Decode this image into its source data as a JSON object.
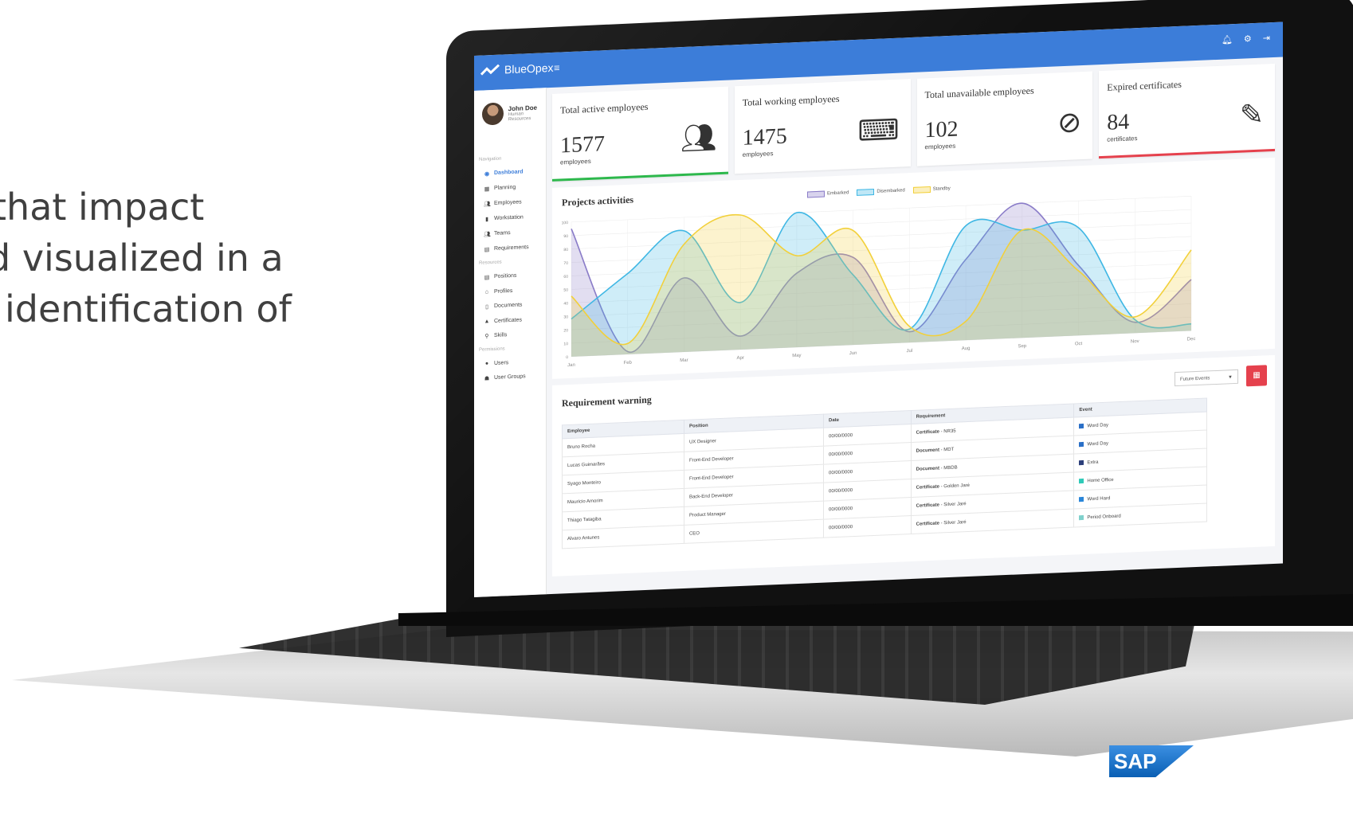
{
  "slide": {
    "lines": [
      "that impact",
      "d visualized in a",
      "identification of"
    ]
  },
  "app": {
    "brand": "BlueOpex",
    "menu_icon": "hamburger-icon",
    "top_icons": [
      "bell-icon",
      "gear-icon",
      "logout-icon"
    ]
  },
  "user": {
    "name": "John Doe",
    "role": "Human Resources"
  },
  "sidebar": {
    "sections": [
      {
        "label": "Navigation",
        "items": [
          {
            "label": "Dashboard",
            "icon": "dashboard-icon",
            "active": true
          },
          {
            "label": "Planning",
            "icon": "calendar-icon"
          },
          {
            "label": "Employees",
            "icon": "users-icon"
          },
          {
            "label": "Workstation",
            "icon": "building-icon"
          },
          {
            "label": "Teams",
            "icon": "team-icon"
          },
          {
            "label": "Requirements",
            "icon": "list-icon"
          }
        ]
      },
      {
        "label": "Resources",
        "items": [
          {
            "label": "Positions",
            "icon": "table-icon"
          },
          {
            "label": "Profiles",
            "icon": "bank-icon"
          },
          {
            "label": "Documents",
            "icon": "file-icon"
          },
          {
            "label": "Certificates",
            "icon": "graduation-cap-icon"
          },
          {
            "label": "Skills",
            "icon": "pin-icon"
          }
        ]
      },
      {
        "label": "Permissions",
        "items": [
          {
            "label": "Users",
            "icon": "user-icon"
          },
          {
            "label": "User Groups",
            "icon": "user-group-icon"
          }
        ]
      }
    ]
  },
  "cards": [
    {
      "title": "Total active employees",
      "value": "1577",
      "unit": "employees",
      "icon": "people-icon",
      "bar_color": "#2db84c"
    },
    {
      "title": "Total working employees",
      "value": "1475",
      "unit": "employees",
      "icon": "desk-worker-icon",
      "bar_color": ""
    },
    {
      "title": "Total unavailable employees",
      "value": "102",
      "unit": "employees",
      "icon": "ban-icon",
      "bar_color": ""
    },
    {
      "title": "Expired certificates",
      "value": "84",
      "unit": "certificates",
      "icon": "certificate-icon",
      "bar_color": "#e5414d"
    }
  ],
  "chart_panel": {
    "title": "Projects activities"
  },
  "chart_data": {
    "type": "area",
    "categories": [
      "Jan",
      "Feb",
      "Mar",
      "Apr",
      "May",
      "Jun",
      "Jul",
      "Aug",
      "Sep",
      "Oct",
      "Nov",
      "Dec"
    ],
    "ylim": [
      0,
      100
    ],
    "yticks": [
      0,
      10,
      20,
      30,
      40,
      50,
      60,
      70,
      80,
      90,
      100
    ],
    "grid": true,
    "legend_position": "top",
    "series": [
      {
        "name": "Embarked",
        "color": "#8a7cc8",
        "values": [
          95,
          2,
          55,
          10,
          55,
          65,
          8,
          60,
          100,
          52,
          8,
          38
        ]
      },
      {
        "name": "Disembarked",
        "color": "#3fb7e4",
        "values": [
          28,
          60,
          90,
          35,
          100,
          52,
          10,
          85,
          80,
          80,
          10,
          5
        ]
      },
      {
        "name": "Standby",
        "color": "#f2d03a",
        "values": [
          45,
          8,
          80,
          100,
          68,
          85,
          12,
          14,
          80,
          48,
          12,
          60
        ]
      }
    ]
  },
  "requirements": {
    "title": "Requirement warning",
    "filter": "Future Events",
    "columns": [
      "Employee",
      "Position",
      "Date",
      "Requirement",
      "Event"
    ],
    "rows": [
      {
        "employee": "Bruno Rocha",
        "position": "UX Designer",
        "date": "00/00/0000",
        "req_type": "Certificate",
        "req_name": "NR35",
        "event": "Word Day",
        "event_color": "#2a6fc7"
      },
      {
        "employee": "Lucas Guimarães",
        "position": "Front-End Developer",
        "date": "00/00/0000",
        "req_type": "Document",
        "req_name": "MDT",
        "event": "Word Day",
        "event_color": "#2a6fc7"
      },
      {
        "employee": "Syago Monteiro",
        "position": "Front-End Developer",
        "date": "00/00/0000",
        "req_type": "Document",
        "req_name": "MBDB",
        "event": "Extra",
        "event_color": "#2c3f7a"
      },
      {
        "employee": "Mauricio Amorim",
        "position": "Back-End Developer",
        "date": "00/00/0000",
        "req_type": "Certificate",
        "req_name": "Golden Jaré",
        "event": "Home Office",
        "event_color": "#2fcab8"
      },
      {
        "employee": "Thiago Tatagiba",
        "position": "Product Manager",
        "date": "00/00/0000",
        "req_type": "Certificate",
        "req_name": "Silver Jaré",
        "event": "Word Hard",
        "event_color": "#2a86d9"
      },
      {
        "employee": "Alvaro Antunes",
        "position": "CEO",
        "date": "00/00/0000",
        "req_type": "Certificate",
        "req_name": "Silver Jaré",
        "event": "Period Onboard",
        "event_color": "#7fd1cc"
      }
    ]
  }
}
